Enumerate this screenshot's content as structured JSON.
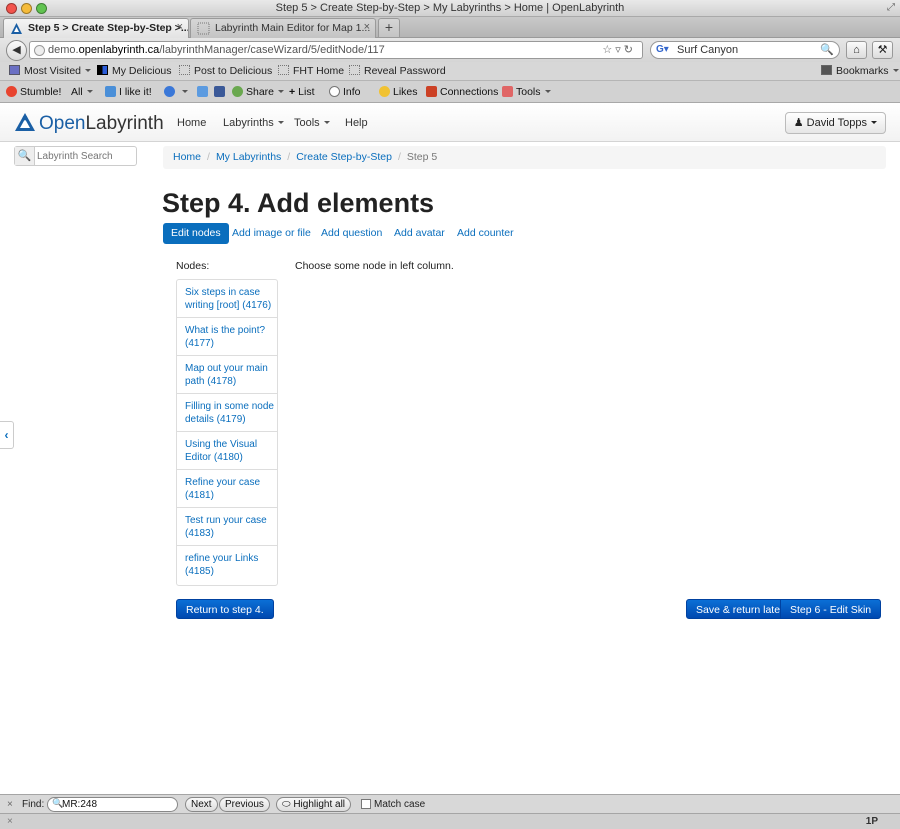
{
  "window": {
    "title": "Step 5 > Create Step-by-Step > My Labyrinths > Home | OpenLabyrinth"
  },
  "tabs": [
    {
      "label": "Step 5 > Create Step-by-Step >..."
    },
    {
      "label": "Labyrinth Main Editor for Map 1..."
    }
  ],
  "urlbar": {
    "prefix": "demo.",
    "domain": "openlabyrinth.ca",
    "path": "/labyrinthManager/caseWizard/5/editNode/117"
  },
  "searchbar": {
    "value": "Surf Canyon"
  },
  "bookmarks": {
    "left": [
      "Most Visited",
      "My Delicious",
      "Post to Delicious",
      "FHT Home",
      "Reveal Password"
    ],
    "right": "Bookmarks"
  },
  "addons": [
    "Stumble!",
    "All",
    "I like it!",
    "Share",
    "List",
    "Info",
    "Likes",
    "Connections",
    "Tools"
  ],
  "site": {
    "logo_prefix": "Open",
    "logo_suffix": "Labyrinth",
    "menu": [
      "Home",
      "Labyrinths",
      "Tools",
      "Help"
    ],
    "user": "David Topps",
    "search_placeholder": "Labyrinth Search"
  },
  "breadcrumb": [
    "Home",
    "My Labyrinths",
    "Create Step-by-Step",
    "Step 5"
  ],
  "page": {
    "title": "Step 4. Add elements",
    "subtabs": [
      "Edit nodes",
      "Add image or file",
      "Add question",
      "Add avatar",
      "Add counter"
    ],
    "nodes_label": "Nodes:",
    "hint": "Choose some node in left column.",
    "nodes": [
      "Six steps in case writing [root] (4176)",
      "What is the point? (4177)",
      "Map out your main path (4178)",
      "Filling in some node details (4179)",
      "Using the Visual Editor (4180)",
      "Refine your case (4181)",
      "Test run your case (4183)",
      "refine your Links (4185)"
    ],
    "return_button": "Return to step 4.",
    "save_button": "Save & return later",
    "next_button": "Step 6 - Edit Skin"
  },
  "findbar": {
    "label": "Find:",
    "value": "MR:248",
    "next": "Next",
    "previous": "Previous",
    "highlight": "Highlight all",
    "match_case": "Match case"
  },
  "status": {
    "right": "1P"
  },
  "colors": {
    "link": "#0a6ebd",
    "primary_button": "#0049b0"
  }
}
